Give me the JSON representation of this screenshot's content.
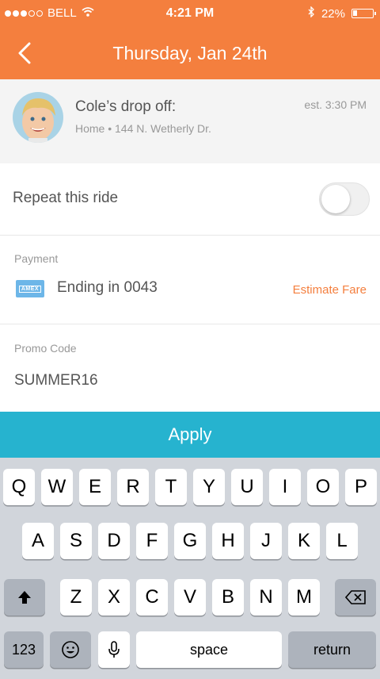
{
  "status_bar": {
    "carrier": "BELL",
    "time": "4:21 PM",
    "battery": "22%",
    "battery_level": 0.22
  },
  "nav": {
    "title": "Thursday, Jan 24th"
  },
  "ride": {
    "name": "Cole’s drop off:",
    "address": "Home • 144 N. Wetherly Dr.",
    "eta": "est. 3:30 PM"
  },
  "repeat": {
    "label": "Repeat this ride",
    "enabled": false
  },
  "payment": {
    "section_label": "Payment",
    "card_text": "Ending in 0043",
    "card_brand": "AMEX",
    "estimate_label": "Estimate Fare"
  },
  "promo": {
    "section_label": "Promo Code",
    "value": "SUMMER16"
  },
  "apply_label": "Apply",
  "keyboard": {
    "row1": [
      "Q",
      "W",
      "E",
      "R",
      "T",
      "Y",
      "U",
      "I",
      "O",
      "P"
    ],
    "row2": [
      "A",
      "S",
      "D",
      "F",
      "G",
      "H",
      "J",
      "K",
      "L"
    ],
    "row3": [
      "Z",
      "X",
      "C",
      "V",
      "B",
      "N",
      "M"
    ],
    "numbers_label": "123",
    "space_label": "space",
    "return_label": "return"
  },
  "colors": {
    "accent": "#f47f3e",
    "apply": "#26b3cf"
  }
}
